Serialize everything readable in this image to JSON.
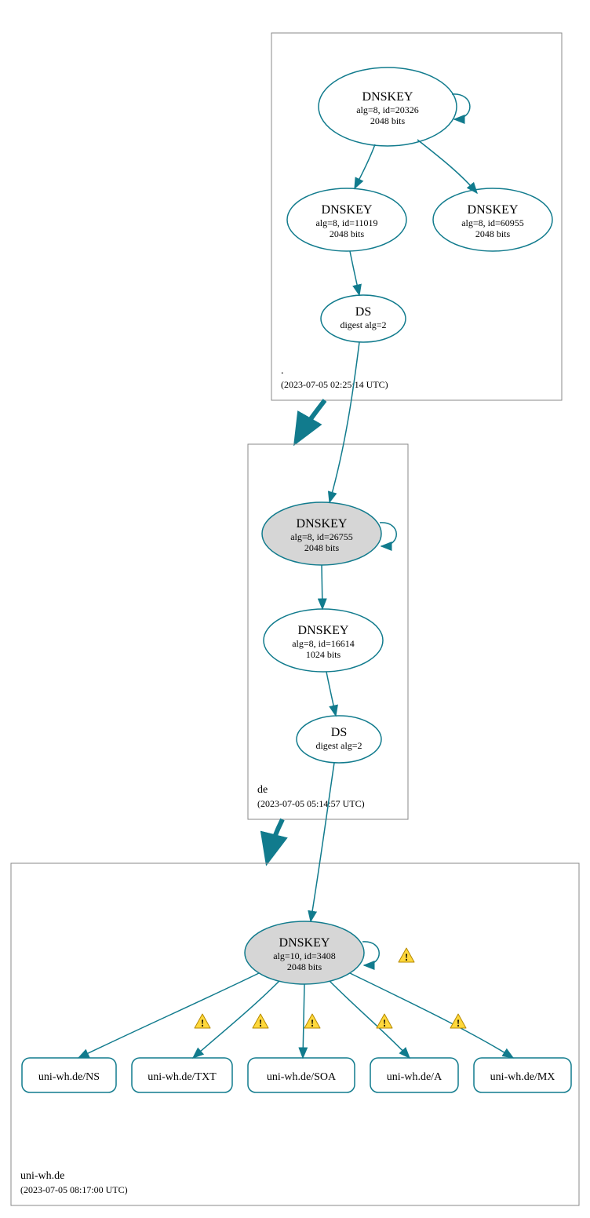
{
  "zones": {
    "root": {
      "label": ".",
      "timestamp": "(2023-07-05 02:25:14 UTC)",
      "nodes": {
        "ksk": {
          "title": "DNSKEY",
          "line1": "alg=8, id=20326",
          "line2": "2048 bits"
        },
        "zsk1": {
          "title": "DNSKEY",
          "line1": "alg=8, id=11019",
          "line2": "2048 bits"
        },
        "zsk2": {
          "title": "DNSKEY",
          "line1": "alg=8, id=60955",
          "line2": "2048 bits"
        },
        "ds": {
          "title": "DS",
          "line1": "digest alg=2"
        }
      }
    },
    "de": {
      "label": "de",
      "timestamp": "(2023-07-05 05:14:57 UTC)",
      "nodes": {
        "ksk": {
          "title": "DNSKEY",
          "line1": "alg=8, id=26755",
          "line2": "2048 bits"
        },
        "zsk": {
          "title": "DNSKEY",
          "line1": "alg=8, id=16614",
          "line2": "1024 bits"
        },
        "ds": {
          "title": "DS",
          "line1": "digest alg=2"
        }
      }
    },
    "uniwh": {
      "label": "uni-wh.de",
      "timestamp": "(2023-07-05 08:17:00 UTC)",
      "nodes": {
        "ksk": {
          "title": "DNSKEY",
          "line1": "alg=10, id=3408",
          "line2": "2048 bits"
        }
      }
    }
  },
  "rrsets": {
    "ns": "uni-wh.de/NS",
    "txt": "uni-wh.de/TXT",
    "soa": "uni-wh.de/SOA",
    "a": "uni-wh.de/A",
    "mx": "uni-wh.de/MX"
  },
  "warn_glyph": "!"
}
